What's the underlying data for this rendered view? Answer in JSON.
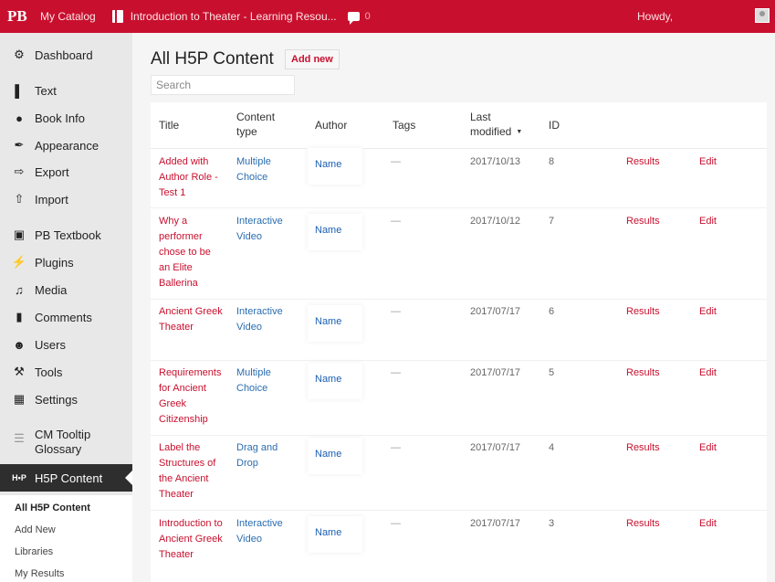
{
  "topbar": {
    "logo": "PB",
    "catalog": "My Catalog",
    "book": "Introduction to Theater - Learning Resou...",
    "comments_count": "0",
    "howdy": "Howdy,"
  },
  "sidebar": {
    "items": [
      {
        "label": "Dashboard",
        "icon": "dashboard-icon",
        "glyph": "⚙"
      },
      {
        "label": "Text",
        "icon": "text-icon",
        "glyph": "▌"
      },
      {
        "label": "Book Info",
        "icon": "info-icon",
        "glyph": "●"
      },
      {
        "label": "Appearance",
        "icon": "brush-icon",
        "glyph": "✒"
      },
      {
        "label": "Export",
        "icon": "export-icon",
        "glyph": "⇨"
      },
      {
        "label": "Import",
        "icon": "import-icon",
        "glyph": "⇧"
      },
      {
        "label": "PB Textbook",
        "icon": "textbook-icon",
        "glyph": "▣"
      },
      {
        "label": "Plugins",
        "icon": "plugin-icon",
        "glyph": "⚡"
      },
      {
        "label": "Media",
        "icon": "media-icon",
        "glyph": "♫"
      },
      {
        "label": "Comments",
        "icon": "comment-icon",
        "glyph": "▮"
      },
      {
        "label": "Users",
        "icon": "users-icon",
        "glyph": "☻"
      },
      {
        "label": "Tools",
        "icon": "wrench-icon",
        "glyph": "⚒"
      },
      {
        "label": "Settings",
        "icon": "settings-icon",
        "glyph": "▦"
      },
      {
        "label": "CM Tooltip Glossary",
        "icon": "glossary-icon",
        "glyph": "☰"
      },
      {
        "label": "H5P Content",
        "icon": "h5p-icon",
        "glyph": "H•P"
      }
    ],
    "submenu": [
      "All H5P Content",
      "Add New",
      "Libraries",
      "My Results"
    ]
  },
  "main": {
    "title": "All H5P Content",
    "add_new": "Add new",
    "search_placeholder": "Search",
    "columns": [
      "Title",
      "Content type",
      "Author",
      "Tags",
      "Last modified",
      "ID"
    ],
    "rows": [
      {
        "title": "Added with Author Role - Test 1",
        "type": "Multiple Choice",
        "author": "Name",
        "tags": "—",
        "date": "2017/10/13",
        "id": "8",
        "results": "Results",
        "edit": "Edit"
      },
      {
        "title": "Why a performer chose to be an Elite Ballerina",
        "type": "Interactive Video",
        "author": "Name",
        "tags": "—",
        "date": "2017/10/12",
        "id": "7",
        "results": "Results",
        "edit": "Edit"
      },
      {
        "title": "Ancient Greek Theater",
        "type": "Interactive Video",
        "author": "Name",
        "tags": "—",
        "date": "2017/07/17",
        "id": "6",
        "results": "Results",
        "edit": "Edit"
      },
      {
        "title": "Requirements for Ancient Greek Citizenship",
        "type": "Multiple Choice",
        "author": "Name",
        "tags": "—",
        "date": "2017/07/17",
        "id": "5",
        "results": "Results",
        "edit": "Edit"
      },
      {
        "title": "Label the Structures of the Ancient Theater",
        "type": "Drag and Drop",
        "author": "Name",
        "tags": "—",
        "date": "2017/07/17",
        "id": "4",
        "results": "Results",
        "edit": "Edit"
      },
      {
        "title": "Introduction to Ancient Greek Theater",
        "type": "Interactive Video",
        "author": "Name",
        "tags": "—",
        "date": "2017/07/17",
        "id": "3",
        "results": "Results",
        "edit": "Edit"
      }
    ]
  },
  "colors": {
    "brand": "#c8102e",
    "link_blue": "#2a6db0",
    "sidebar_active": "#2e2e2e"
  }
}
